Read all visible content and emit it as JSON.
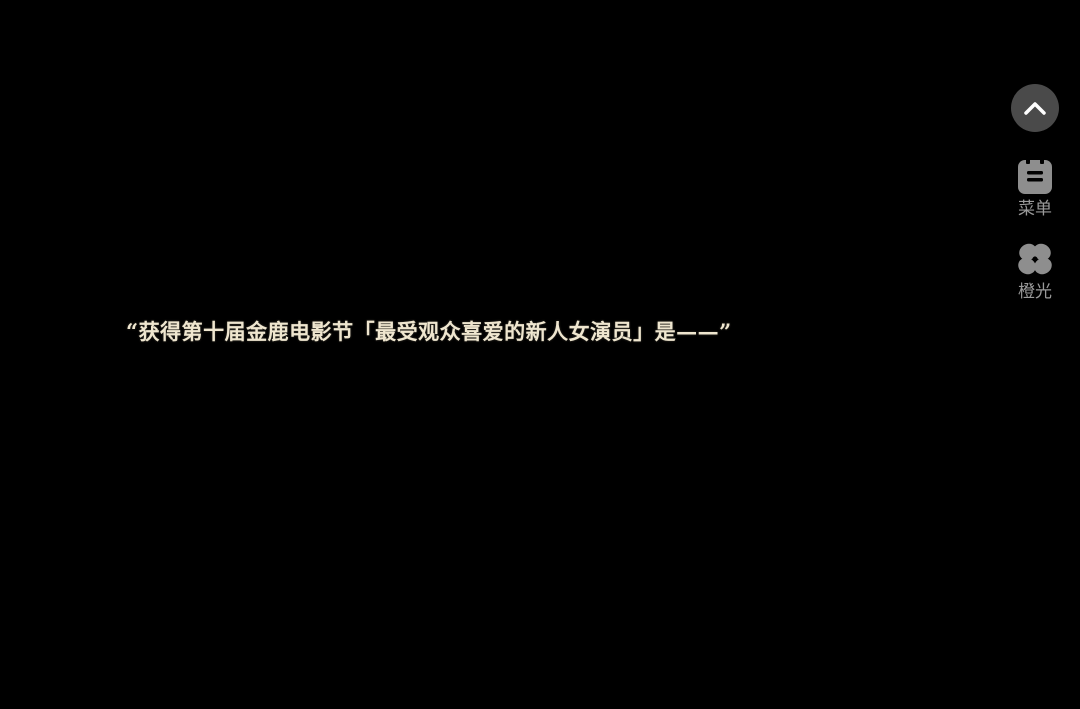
{
  "dialogue": {
    "text": "“获得第十届金鹿电影节「最受观众喜爱的新人女演员」是——”"
  },
  "side_controls": {
    "collapse_icon": "chevron-up-icon",
    "items": [
      {
        "label": "菜单",
        "icon": "menu-icon"
      },
      {
        "label": "橙光",
        "icon": "clover-icon"
      }
    ]
  },
  "colors": {
    "background": "#000000",
    "dialogue_text": "#efe6cf",
    "control_bg": "#4a4a4a",
    "control_label": "#9a9a9a"
  }
}
